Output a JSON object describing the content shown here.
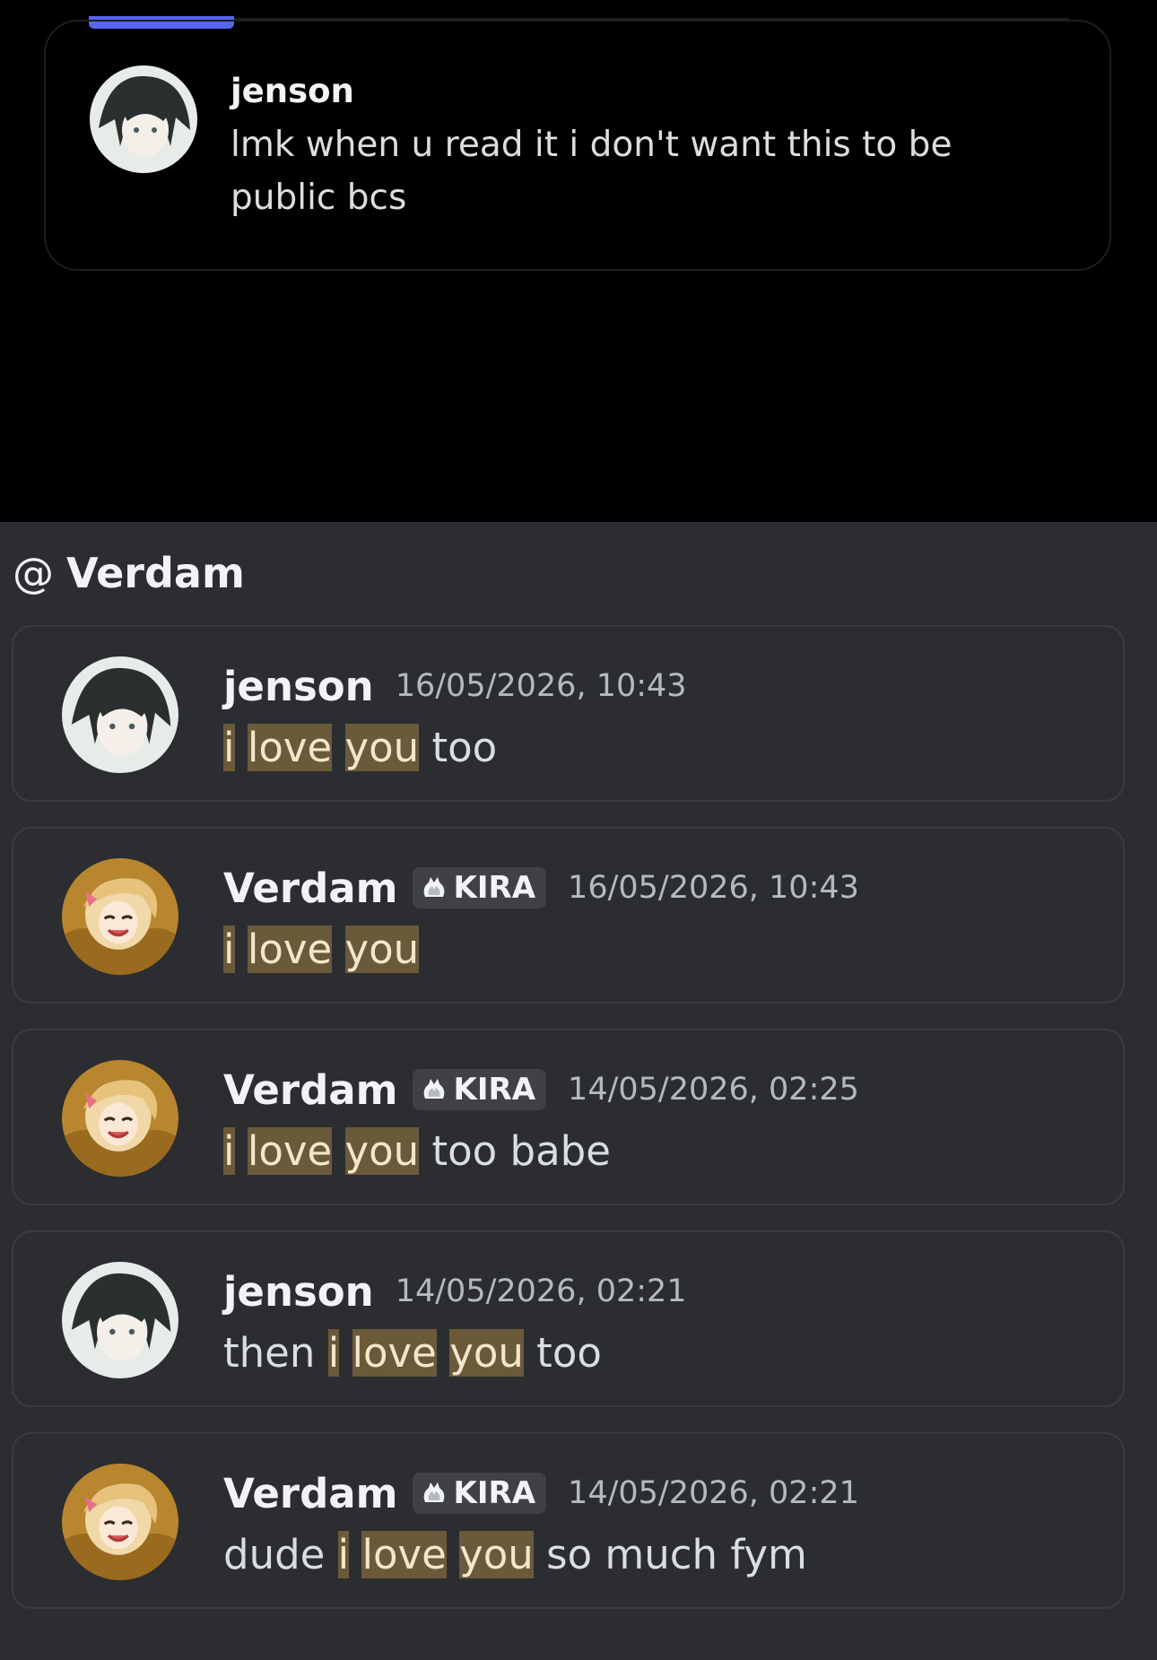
{
  "reply_preview": {
    "author": "jenson",
    "text": "lmk when u read it i don't want this to be public bcs",
    "avatar": "dark-haired-anime-avatar"
  },
  "search": {
    "at_symbol": "@",
    "channel": "Verdam"
  },
  "messages": [
    {
      "author": "jenson",
      "tag": "",
      "timestamp": "16/05/2026, 10:43",
      "avatar": "dark-haired-anime-avatar",
      "segments": [
        {
          "text": "i",
          "hl": true
        },
        {
          "text": " ",
          "hl": false
        },
        {
          "text": "love",
          "hl": true
        },
        {
          "text": " ",
          "hl": false
        },
        {
          "text": "you",
          "hl": true
        },
        {
          "text": " too",
          "hl": false
        }
      ]
    },
    {
      "author": "Verdam",
      "tag": "KIRA",
      "timestamp": "16/05/2026, 10:43",
      "avatar": "blonde-anime-avatar",
      "segments": [
        {
          "text": "i",
          "hl": true
        },
        {
          "text": " ",
          "hl": false
        },
        {
          "text": "love",
          "hl": true
        },
        {
          "text": " ",
          "hl": false
        },
        {
          "text": "you",
          "hl": true
        }
      ]
    },
    {
      "author": "Verdam",
      "tag": "KIRA",
      "timestamp": "14/05/2026, 02:25",
      "avatar": "blonde-anime-avatar",
      "segments": [
        {
          "text": "i",
          "hl": true
        },
        {
          "text": " ",
          "hl": false
        },
        {
          "text": "love",
          "hl": true
        },
        {
          "text": " ",
          "hl": false
        },
        {
          "text": "you",
          "hl": true
        },
        {
          "text": " too babe",
          "hl": false
        }
      ]
    },
    {
      "author": "jenson",
      "tag": "",
      "timestamp": "14/05/2026, 02:21",
      "avatar": "dark-haired-anime-avatar",
      "segments": [
        {
          "text": "then ",
          "hl": false
        },
        {
          "text": "i",
          "hl": true
        },
        {
          "text": " ",
          "hl": false
        },
        {
          "text": "love",
          "hl": true
        },
        {
          "text": " ",
          "hl": false
        },
        {
          "text": "you",
          "hl": true
        },
        {
          "text": " too",
          "hl": false
        }
      ]
    },
    {
      "author": "Verdam",
      "tag": "KIRA",
      "timestamp": "14/05/2026, 02:21",
      "avatar": "blonde-anime-avatar",
      "segments": [
        {
          "text": "dude ",
          "hl": false
        },
        {
          "text": "i",
          "hl": true
        },
        {
          "text": " ",
          "hl": false
        },
        {
          "text": "love",
          "hl": true
        },
        {
          "text": " ",
          "hl": false
        },
        {
          "text": "you",
          "hl": true
        },
        {
          "text": " so much fym",
          "hl": false
        }
      ]
    }
  ],
  "colors": {
    "accent": "#5865f2",
    "highlight": "#6b5a3a",
    "panel": "#2b2d31"
  }
}
